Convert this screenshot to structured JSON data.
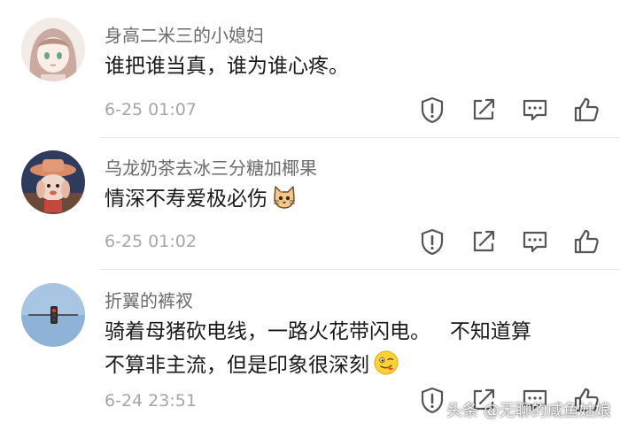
{
  "comments": [
    {
      "username": "身高二米三的小媳妇",
      "text_lines": [
        "谁把谁当真，谁为谁心疼。"
      ],
      "time": "6-25 01:07",
      "avatar": "anime-girl-avatar"
    },
    {
      "username": "乌龙奶茶去冰三分糖加椰果",
      "text_lines": [
        "情深不寿爱极必伤"
      ],
      "emoji": "cat-face-emoji",
      "time": "6-25 01:02",
      "avatar": "cartoon-character-avatar"
    },
    {
      "username": "折翼的裤衩",
      "text_lines": [
        "骑着母猪砍电线，一路火花带闪电。   不知道算",
        "不算非主流，但是印象很深刻"
      ],
      "emoji": "tongue-out-emoji",
      "time": "6-24 23:51",
      "avatar": "traffic-light-avatar"
    }
  ],
  "actions": [
    "report-icon",
    "share-icon",
    "reply-icon",
    "like-icon"
  ],
  "watermark": "头条 @无聊的咸鱼姑娘",
  "colors": {
    "username": "#6b6b6b",
    "text": "#1a1a1a",
    "time": "#a6a6a6",
    "icon": "#555555",
    "divider": "#e6e6e6"
  }
}
